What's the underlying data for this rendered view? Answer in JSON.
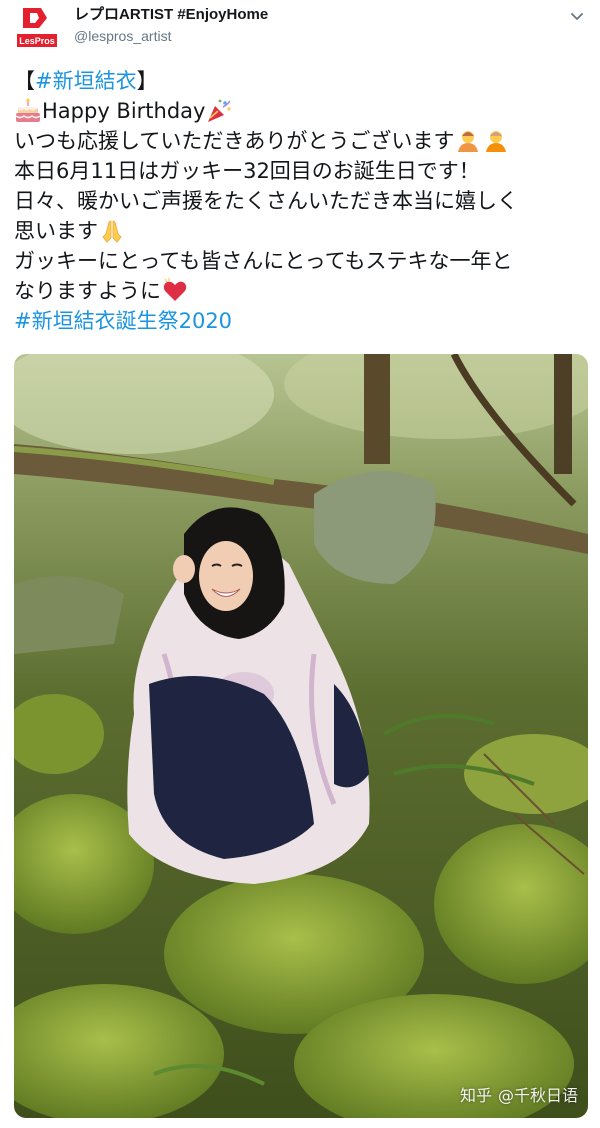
{
  "account": {
    "display_name": "レプロARTIST #EnjoyHome",
    "handle": "@lespros_artist",
    "logo_text": "LesPros"
  },
  "tweet": {
    "l1_open": "【",
    "l1_hashtag": "#新垣結衣",
    "l1_close": "】",
    "l2": "Happy Birthday",
    "l3": "いつも応援していただきありがとうございます",
    "l4": "本日6月11日はガッキー32回目のお誕生日です！",
    "l5": "日々、暖かいご声援をたくさんいただき本当に嬉しく",
    "l6": "思います",
    "l7": "ガッキーにとっても皆さんにとってもステキな一年と",
    "l8": "なりますように",
    "l9_hashtag": "#新垣結衣誕生祭2020"
  },
  "icons": [
    "logo-icon",
    "chevron-down-icon",
    "birthday-cake-icon",
    "party-popper-icon",
    "person-bowing-icon",
    "folded-hands-icon",
    "heart-icon"
  ],
  "watermark": {
    "site": "知乎",
    "author": "@千秋日语"
  }
}
